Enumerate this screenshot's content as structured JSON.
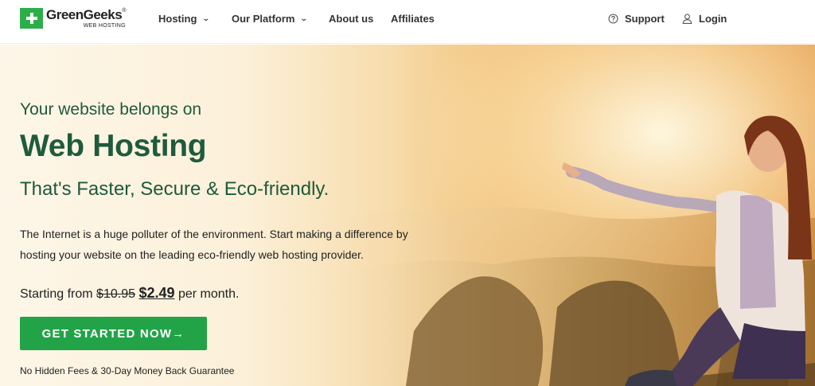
{
  "brand": {
    "name": "GreenGeeks",
    "reg_mark": "®",
    "tagline": "WEB HOSTING",
    "logo_icon": "plus-icon",
    "color": "#2eae4b"
  },
  "nav": {
    "items": [
      {
        "label": "Hosting",
        "has_dropdown": true
      },
      {
        "label": "Our Platform",
        "has_dropdown": true
      },
      {
        "label": "About us",
        "has_dropdown": false
      },
      {
        "label": "Affiliates",
        "has_dropdown": false
      }
    ],
    "support_label": "Support",
    "support_icon": "help-circle-icon",
    "login_label": "Login",
    "login_icon": "user-icon"
  },
  "hero": {
    "tagline": "Your website belongs on",
    "headline": "Web Hosting",
    "subhead": "That's Faster, Secure & Eco-friendly.",
    "description": "The Internet is a huge polluter of the environment. Start making a difference by hosting your website on the leading eco-friendly web hosting provider.",
    "price_prefix": "Starting from",
    "price_old": "$10.95",
    "price_new": "$2.49",
    "price_suffix": "per month.",
    "cta_label": "GET STARTED NOW→",
    "guarantee": "No Hidden Fees & 30-Day Money Back Guarantee",
    "text_color": "#1f5a3c",
    "cta_color": "#22a348"
  }
}
